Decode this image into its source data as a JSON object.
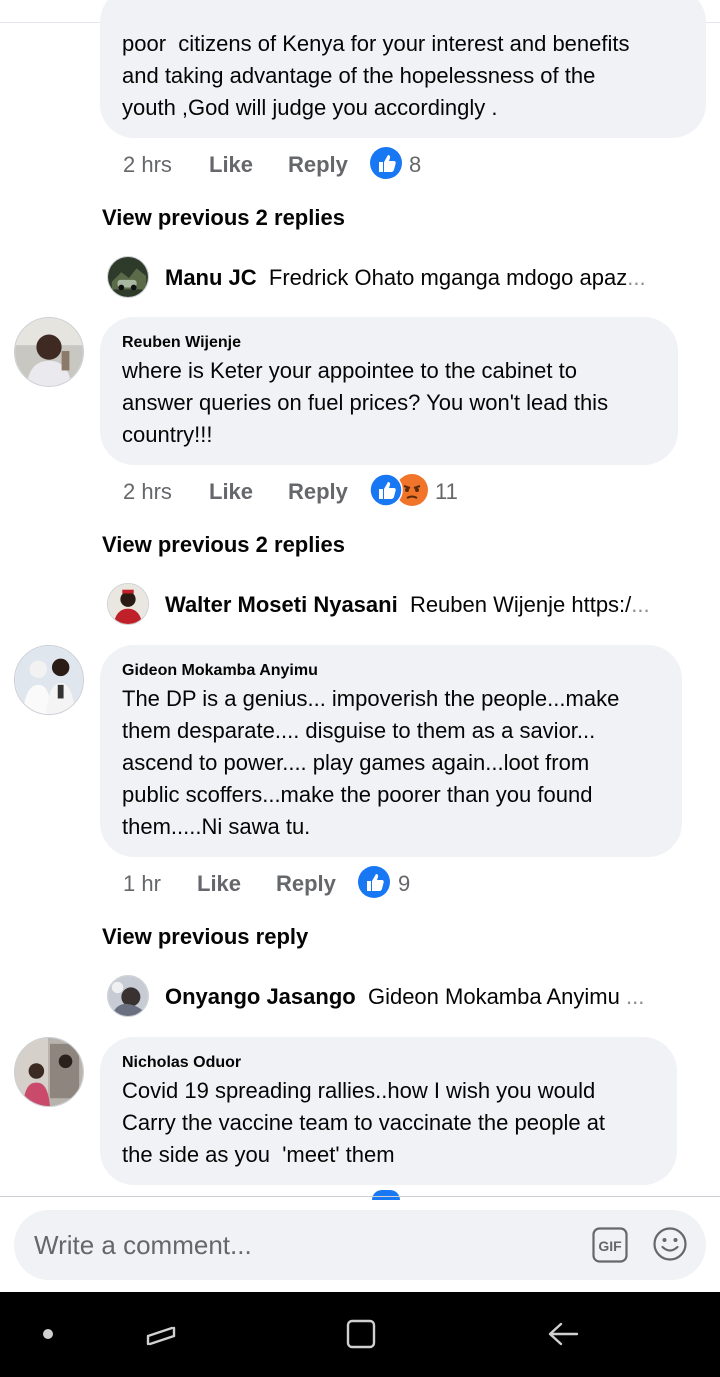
{
  "comments": [
    {
      "author": "",
      "text": "poor  citizens of Kenya for your interest and benefits\nand taking advantage of the hopelessness of the\nyouth ,God will judge you accordingly .",
      "time": "2 hrs",
      "like_label": "Like",
      "reply_label": "Reply",
      "reactions": [
        "like"
      ],
      "reaction_count": "8",
      "view_previous": "View previous 2 replies",
      "latest_reply": {
        "author": "Manu JC",
        "text": "Fredrick Ohato mganga mdogo apaz",
        "ellipsis": "..."
      }
    },
    {
      "author": "Reuben Wijenje",
      "text": "where is Keter your appointee to the cabinet to\nanswer queries on fuel prices? You won't lead this\ncountry!!!",
      "time": "2 hrs",
      "like_label": "Like",
      "reply_label": "Reply",
      "reactions": [
        "like",
        "angry"
      ],
      "reaction_count": "11",
      "view_previous": "View previous 2 replies",
      "latest_reply": {
        "author": "Walter Moseti Nyasani",
        "text": "Reuben Wijenje https:/",
        "ellipsis": "..."
      }
    },
    {
      "author": "Gideon Mokamba Anyimu",
      "text": "The DP is a genius... impoverish the people...make\nthem desparate.... disguise to them as a savior...\nascend to power.... play games again...loot from\npublic scoffers...make the poorer than you found\nthem.....Ni sawa tu.",
      "time": "1 hr",
      "like_label": "Like",
      "reply_label": "Reply",
      "reactions": [
        "like"
      ],
      "reaction_count": "9",
      "view_previous": "View previous reply",
      "latest_reply": {
        "author": "Onyango Jasango",
        "text": "Gideon Mokamba Anyimu ",
        "ellipsis": "..."
      }
    },
    {
      "author": "Nicholas Oduor",
      "text": "Covid 19 spreading rallies..how I wish you would\nCarry the vaccine team to vaccinate the people at\nthe side as you  'meet' them"
    }
  ],
  "composer": {
    "placeholder": "Write a comment...",
    "gif_label": "GIF",
    "emoji_icon": "smiley-icon"
  },
  "colors": {
    "bubble": "#f0f2f5",
    "like_blue": "#1877f2",
    "angry_orange": "#f0752b",
    "meta_gray": "#65676b"
  }
}
